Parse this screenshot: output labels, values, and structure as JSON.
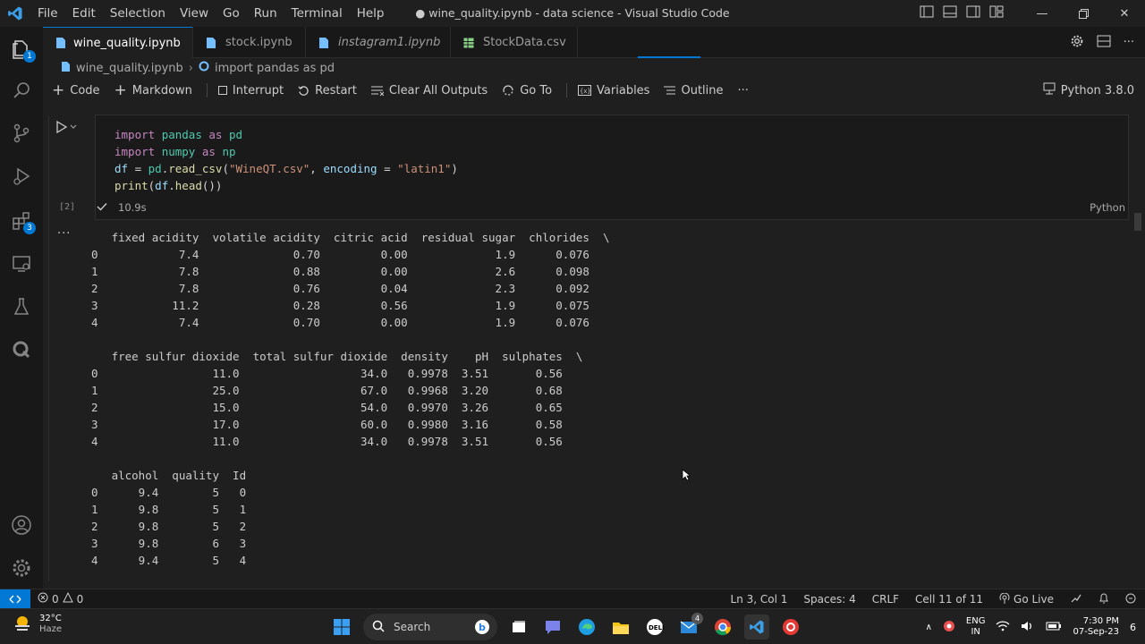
{
  "window": {
    "title": "● wine_quality.ipynb - data science - Visual Studio Code",
    "menu": [
      "File",
      "Edit",
      "Selection",
      "View",
      "Go",
      "Run",
      "Terminal",
      "Help"
    ]
  },
  "activity_bar": {
    "explorer_badge": "1",
    "extensions_badge": "3"
  },
  "tabs": [
    {
      "label": "wine_quality.ipynb",
      "active": true,
      "dirty": true
    },
    {
      "label": "stock.ipynb",
      "active": false
    },
    {
      "label": "instagram1.ipynb",
      "active": false,
      "italic": true
    },
    {
      "label": "StockData.csv",
      "active": false
    }
  ],
  "breadcrumb": {
    "file": "wine_quality.ipynb",
    "symbol": "import pandas as pd"
  },
  "toolbar": {
    "code": "Code",
    "markdown": "Markdown",
    "interrupt": "Interrupt",
    "restart": "Restart",
    "clear_outputs": "Clear All Outputs",
    "go_to": "Go To",
    "variables": "Variables",
    "outline": "Outline",
    "more": "···",
    "kernel": "Python 3.8.0"
  },
  "cell": {
    "execution_count": "[2]",
    "duration": "10.9s",
    "language": "Python",
    "code": {
      "l1": {
        "kw": "import",
        "mod": "pandas",
        "as": "as",
        "alias": "pd"
      },
      "l2": {
        "kw": "import",
        "mod": "numpy",
        "as": "as",
        "alias": "np"
      },
      "l3": {
        "var": "df",
        "eq": " = ",
        "obj": "pd",
        "fn": "read_csv",
        "arg1": "\"WineQT.csv\"",
        "param": "encoding",
        "eq2": " = ",
        "arg2": "\"latin1\""
      },
      "l4": {
        "fn": "print",
        "obj": "df",
        "method": "head"
      }
    },
    "output_dots": "···",
    "output": "   fixed acidity  volatile acidity  citric acid  residual sugar  chlorides  \\\n0            7.4              0.70         0.00             1.9      0.076   \n1            7.8              0.88         0.00             2.6      0.098   \n2            7.8              0.76         0.04             2.3      0.092   \n3           11.2              0.28         0.56             1.9      0.075   \n4            7.4              0.70         0.00             1.9      0.076   \n\n   free sulfur dioxide  total sulfur dioxide  density    pH  sulphates  \\\n0                 11.0                  34.0   0.9978  3.51       0.56   \n1                 25.0                  67.0   0.9968  3.20       0.68   \n2                 15.0                  54.0   0.9970  3.26       0.65   \n3                 17.0                  60.0   0.9980  3.16       0.58   \n4                 11.0                  34.0   0.9978  3.51       0.56   \n\n   alcohol  quality  Id  \n0      9.4        5   0  \n1      9.8        5   1  \n2      9.8        5   2  \n3      9.8        6   3  \n4      9.4        5   4  "
  },
  "statusbar": {
    "errors": "0",
    "warnings": "0",
    "position": "Ln 3, Col 1",
    "spaces": "Spaces: 4",
    "eol": "CRLF",
    "cell": "Cell 11 of 11",
    "golive": "Go Live"
  },
  "taskbar": {
    "temp": "32°C",
    "weather": "Haze",
    "search": "Search",
    "mail_badge": "4",
    "lang_top": "ENG",
    "lang_bottom": "IN",
    "time": "7:30 PM",
    "date": "07-Sep-23",
    "notif": "6"
  },
  "colors": {
    "accent": "#0078d4",
    "editor_bg": "#1f1f1f",
    "keyword": "#c586c0",
    "string": "#ce9178"
  }
}
